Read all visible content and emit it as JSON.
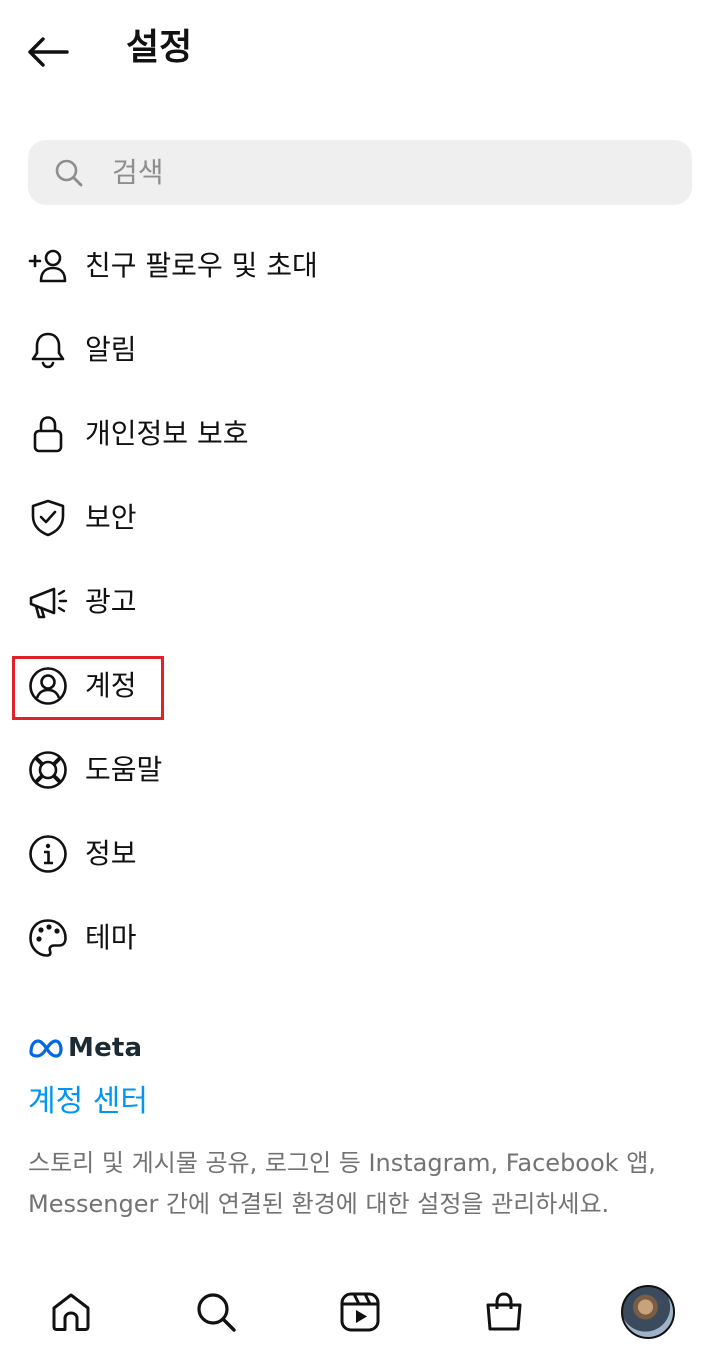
{
  "header": {
    "title": "설정"
  },
  "search": {
    "placeholder": "검색"
  },
  "menu": {
    "items": [
      {
        "label": "친구 팔로우 및 초대",
        "icon": "add-person-icon"
      },
      {
        "label": "알림",
        "icon": "bell-icon"
      },
      {
        "label": "개인정보 보호",
        "icon": "lock-icon"
      },
      {
        "label": "보안",
        "icon": "shield-check-icon"
      },
      {
        "label": "광고",
        "icon": "megaphone-icon"
      },
      {
        "label": "계정",
        "icon": "account-circle-icon"
      },
      {
        "label": "도움말",
        "icon": "lifebuoy-icon"
      },
      {
        "label": "정보",
        "icon": "info-icon"
      },
      {
        "label": "테마",
        "icon": "palette-icon"
      }
    ]
  },
  "meta": {
    "logo_text": "Meta",
    "accounts_center": "계정 센터",
    "description_line1": "스토리 및 게시물 공유, 로그인 등 Instagram, Facebook 앱,",
    "description_line2": "Messenger 간에 연결된 환경에 대한 설정을 관리하세요."
  },
  "bottom_nav": {
    "items": [
      "home-icon",
      "search-icon",
      "reels-icon",
      "shop-bag-icon",
      "profile-avatar"
    ]
  },
  "colors": {
    "accent": "#0095f6",
    "highlight": "#e0202a",
    "search_bg": "#efefef"
  }
}
